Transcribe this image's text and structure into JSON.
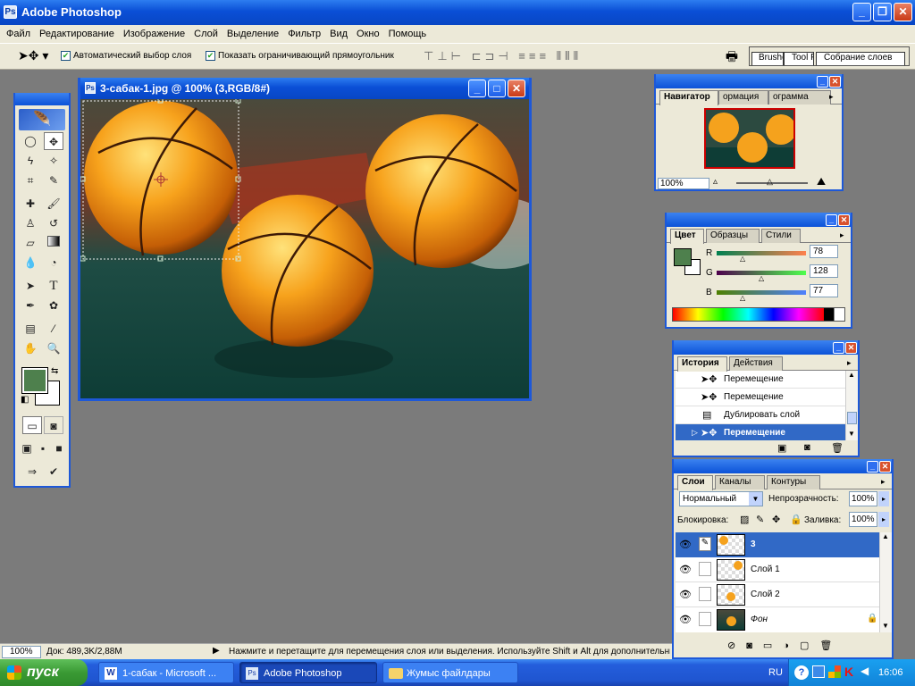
{
  "app": {
    "title": "Adobe Photoshop"
  },
  "menu": [
    "Файл",
    "Редактирование",
    "Изображение",
    "Слой",
    "Выделение",
    "Фильтр",
    "Вид",
    "Окно",
    "Помощь"
  ],
  "options": {
    "auto_select": "Автоматический выбор слоя",
    "show_bbox": "Показать ограничивающий прямоугольник",
    "well_tabs": [
      "Brushe",
      "Tool F",
      "Собрание слоев"
    ]
  },
  "document": {
    "title": "3-сабак-1.jpg @ 100% (3,RGB/8#)"
  },
  "navigator": {
    "tabs": [
      "Навигатор",
      "ормация",
      "ограмма"
    ],
    "zoom": "100%"
  },
  "color": {
    "tabs": [
      "Цвет",
      "Образцы",
      "Стили"
    ],
    "r_label": "R",
    "g_label": "G",
    "b_label": "B",
    "r": 78,
    "g": 128,
    "b": 77,
    "foreground": "#4e804d"
  },
  "history": {
    "tabs": [
      "История",
      "Действия"
    ],
    "items": [
      "Перемещение",
      "Перемещение",
      "Дублировать слой",
      "Перемещение"
    ]
  },
  "layers": {
    "tabs": [
      "Слои",
      "Каналы",
      "Контуры"
    ],
    "blend_mode": "Нормальный",
    "opacity_label": "Непрозрачность:",
    "opacity": "100%",
    "lock_label": "Блокировка:",
    "fill_label": "Заливка:",
    "fill": "100%",
    "items": [
      "3",
      "Слой 1",
      "Слой 2",
      "Фон"
    ]
  },
  "status": {
    "zoom": "100%",
    "doc": "Док: 489,3K/2,88M",
    "hint": "Нажмите и перетащите для перемещения слоя или выделения. Используйте Shift и Alt для дополнительных параметров."
  },
  "taskbar": {
    "start": "пуск",
    "items": [
      "1-сабак - Microsoft ...",
      "Adobe Photoshop",
      "Жумыс файлдары"
    ],
    "lang": "RU",
    "time": "16:06"
  }
}
